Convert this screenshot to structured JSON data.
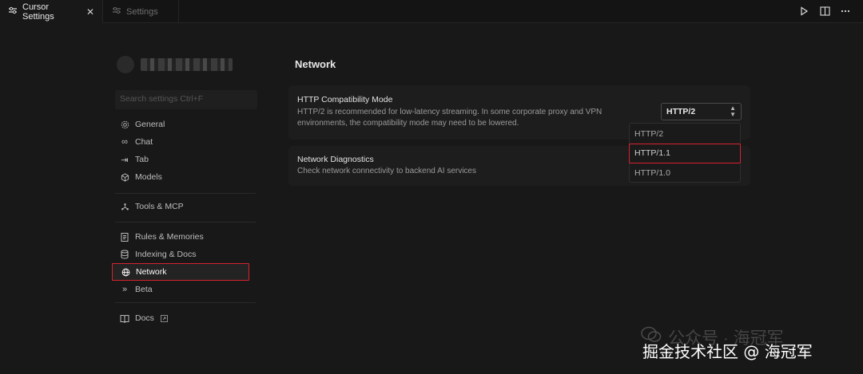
{
  "tabs": [
    {
      "label": "Cursor Settings",
      "active": true,
      "icon": "settings-sliders-icon"
    },
    {
      "label": "Settings",
      "active": false,
      "icon": "settings-sliders-icon"
    }
  ],
  "tabbar_actions": [
    "run-icon",
    "split-editor-icon"
  ],
  "sidebar": {
    "search_placeholder": "Search settings Ctrl+F",
    "groups": [
      [
        {
          "label": "General",
          "icon": "gear-icon"
        },
        {
          "label": "Chat",
          "icon": "infinity-icon"
        },
        {
          "label": "Tab",
          "icon": "tab-arrow-icon"
        },
        {
          "label": "Models",
          "icon": "cube-icon"
        }
      ],
      [
        {
          "label": "Tools & MCP",
          "icon": "tools-icon"
        }
      ],
      [
        {
          "label": "Rules & Memories",
          "icon": "clipboard-icon"
        },
        {
          "label": "Indexing & Docs",
          "icon": "database-icon"
        },
        {
          "label": "Network",
          "icon": "globe-icon",
          "selected": true
        },
        {
          "label": "Beta",
          "icon": "chevrons-right-icon"
        }
      ],
      [
        {
          "label": "Docs",
          "icon": "book-icon"
        }
      ]
    ]
  },
  "main": {
    "title": "Network",
    "http": {
      "title": "HTTP Compatibility Mode",
      "description": "HTTP/2 is recommended for low-latency streaming. In some corporate proxy and VPN environments, the compatibility mode may need to be lowered.",
      "selected_value": "HTTP/2",
      "options": [
        "HTTP/2",
        "HTTP/1.1",
        "HTTP/1.0"
      ],
      "highlighted_option": "HTTP/1.1"
    },
    "diagnostics": {
      "title": "Network Diagnostics",
      "description": "Check network connectivity to backend AI services"
    }
  },
  "watermark": {
    "line1": "公众号 · 海冠军",
    "line2": "掘金技术社区 @ 海冠军"
  },
  "colors": {
    "highlight": "#d6232f",
    "background": "#181818"
  }
}
